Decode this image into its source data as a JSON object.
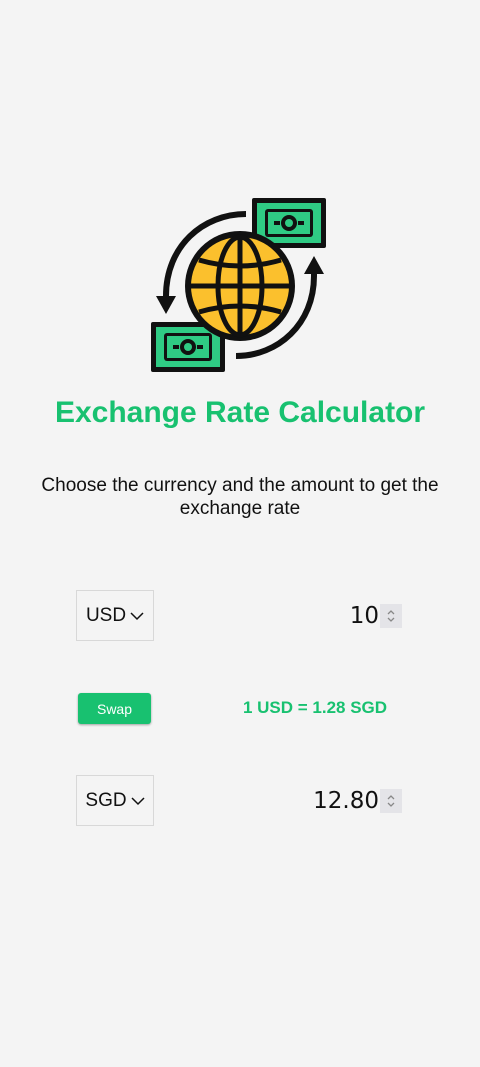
{
  "header": {
    "title": "Exchange Rate Calculator",
    "subtitle": "Choose the currency and the amount to get the exchange rate"
  },
  "logo": {
    "icon": "globe-money-exchange-icon"
  },
  "from": {
    "currency": "USD",
    "amount": "10"
  },
  "to": {
    "currency": "SGD",
    "amount": "12.80"
  },
  "swap_label": "Swap",
  "rate_text": "1 USD = 1.28 SGD",
  "colors": {
    "accent": "#18c170",
    "background": "#f4f4f4",
    "globe": "#fbc02d",
    "bill": "#2fcb84"
  }
}
